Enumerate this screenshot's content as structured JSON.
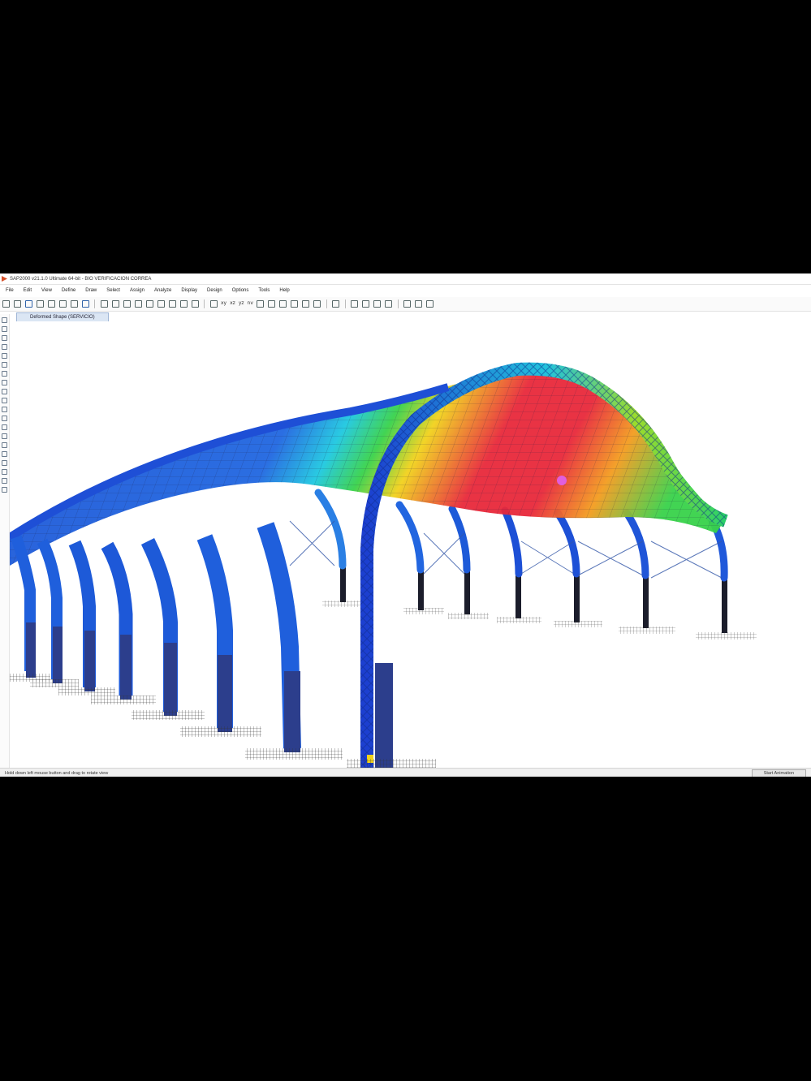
{
  "window": {
    "title": "SAP2000 v21.1.0 Ultimate 64-bit - BIO VERIFICACION CORREA"
  },
  "menu": {
    "items": [
      "File",
      "Edit",
      "View",
      "Define",
      "Draw",
      "Select",
      "Assign",
      "Analyze",
      "Display",
      "Design",
      "Options",
      "Tools",
      "Help"
    ]
  },
  "toolbar": {
    "view_labels": [
      "xy",
      "xz",
      "yz",
      "nv"
    ]
  },
  "tab": {
    "label": "Deformed Shape (SERVICIO)"
  },
  "status": {
    "message": "Hold down left mouse button and drag to rotate view",
    "animation_button": "Start Animation"
  },
  "colors": {
    "frame_blue": "#1f4fd8",
    "contour_red": "#e8283a",
    "contour_yellow": "#f1d21c",
    "contour_green": "#38d24a",
    "contour_cyan": "#1ec8e0",
    "support": "#1b1d2b"
  }
}
